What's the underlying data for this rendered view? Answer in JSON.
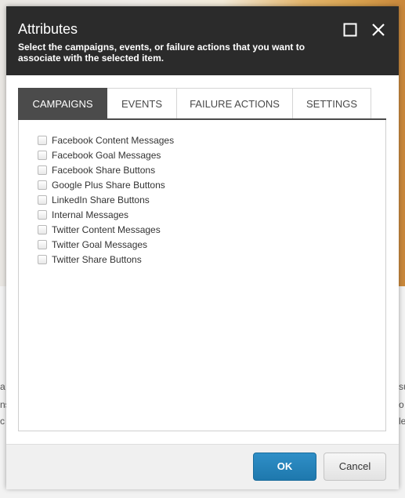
{
  "dialog": {
    "title": "Attributes",
    "subtitle": "Select the campaigns, events, or failure actions that you want to associate with the selected item."
  },
  "tabs": [
    {
      "label": "CAMPAIGNS",
      "active": true
    },
    {
      "label": "EVENTS",
      "active": false
    },
    {
      "label": "FAILURE ACTIONS",
      "active": false
    },
    {
      "label": "SETTINGS",
      "active": false
    }
  ],
  "campaigns": [
    {
      "label": "Facebook Content Messages",
      "checked": false
    },
    {
      "label": "Facebook Goal Messages",
      "checked": false
    },
    {
      "label": "Facebook Share Buttons",
      "checked": false
    },
    {
      "label": "Google Plus Share Buttons",
      "checked": false
    },
    {
      "label": "LinkedIn Share Buttons",
      "checked": false
    },
    {
      "label": "Internal Messages",
      "checked": false
    },
    {
      "label": "Twitter Content Messages",
      "checked": false
    },
    {
      "label": "Twitter Goal Messages",
      "checked": false
    },
    {
      "label": "Twitter Share Buttons",
      "checked": false
    }
  ],
  "footer": {
    "ok_label": "OK",
    "cancel_label": "Cancel"
  },
  "background_fragments": {
    "left": [
      "a",
      "ns",
      "c"
    ],
    "right": [
      "su",
      "o",
      "le"
    ]
  },
  "icons": {
    "maximize": "maximize-icon",
    "close": "close-icon"
  },
  "colors": {
    "header_bg": "#2b2b2b",
    "active_tab_bg": "#4b4b4b",
    "ok_button": "#2384bd"
  }
}
